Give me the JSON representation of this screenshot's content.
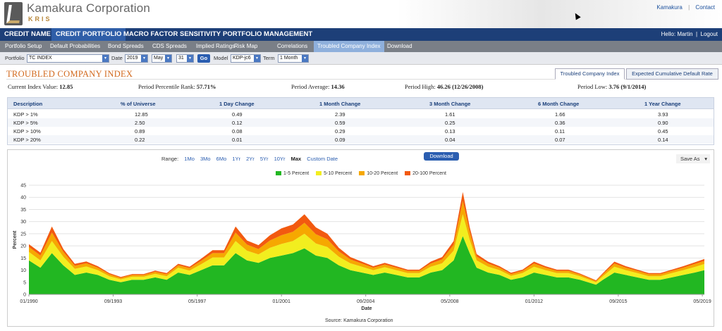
{
  "header": {
    "brand": "Kamakura Corporation",
    "brand_sub": "KRIS",
    "links": [
      "Kamakura",
      "Contact"
    ]
  },
  "main_nav": {
    "items": [
      "CREDIT NAME",
      "CREDIT PORTFOLIO",
      "MACRO FACTOR SENSITIVITY",
      "PORTFOLIO MANAGEMENT"
    ],
    "active": "CREDIT PORTFOLIO",
    "user_greeting": "Hello: Martin",
    "logout": "Logout"
  },
  "sub_nav": {
    "items": [
      "Portfolio Setup",
      "Default Probabilities",
      "Bond Spreads",
      "CDS Spreads",
      "Implied Ratings",
      "Risk Map",
      "Correlations",
      "Troubled Company Index",
      "Download"
    ],
    "active": "Troubled Company Index"
  },
  "filters": {
    "portfolio_label": "Portfolio",
    "portfolio_value": "TC INDEX",
    "date_label": "Date",
    "year": "2019",
    "month": "May",
    "day": "31",
    "go_label": "Go",
    "model_label": "Model",
    "model_value": "KDP-jc6",
    "term_label": "Term",
    "term_value": "1 Month"
  },
  "page": {
    "title": "TROUBLED COMPANY INDEX",
    "tabs": [
      "Troubled Company Index",
      "Expected Cumulative Default Rate"
    ],
    "active_tab": "Troubled Company Index"
  },
  "stats": {
    "current_label": "Current Index Value:",
    "current_value": "12.85",
    "percentile_label": "Period Percentile Rank:",
    "percentile_value": "57.71%",
    "average_label": "Period Average:",
    "average_value": "14.36",
    "high_label": "Period High:",
    "high_value": "46.26 (12/26/2008)",
    "low_label": "Period Low:",
    "low_value": "3.76 (9/1/2014)"
  },
  "table": {
    "headers": [
      "Description",
      "% of Universe",
      "1 Day Change",
      "1 Month Change",
      "3 Month Change",
      "6 Month Change",
      "1 Year Change"
    ],
    "rows": [
      [
        "KDP > 1%",
        "12.85",
        "0.49",
        "2.39",
        "1.61",
        "1.66",
        "3.93"
      ],
      [
        "KDP > 5%",
        "2.50",
        "0.12",
        "0.59",
        "0.25",
        "0.36",
        "0.90"
      ],
      [
        "KDP > 10%",
        "0.89",
        "0.08",
        "0.29",
        "0.13",
        "0.11",
        "0.45"
      ],
      [
        "KDP > 20%",
        "0.22",
        "0.01",
        "0.09",
        "0.04",
        "0.07",
        "0.14"
      ]
    ]
  },
  "chart_controls": {
    "range_label": "Range:",
    "ranges": [
      "1Mo",
      "3Mo",
      "6Mo",
      "1Yr",
      "2Yr",
      "5Yr",
      "10Yr",
      "Max",
      "Custom Date"
    ],
    "selected_range": "Max",
    "download_label": "Download",
    "save_as_label": "Save As"
  },
  "chart_data": {
    "type": "area",
    "stacked": true,
    "xlabel": "Date",
    "ylabel": "Percent",
    "ylim": [
      0,
      45
    ],
    "yticks": [
      0,
      5,
      10,
      15,
      20,
      25,
      30,
      35,
      40,
      45
    ],
    "xtick_labels": [
      "01/1990",
      "09/1993",
      "05/1997",
      "01/2001",
      "09/2004",
      "05/2008",
      "01/2012",
      "09/2015",
      "05/2019"
    ],
    "xtick_years": [
      1990.0,
      1993.67,
      1997.33,
      2001.0,
      2004.67,
      2008.33,
      2012.0,
      2015.67,
      2019.33
    ],
    "x_range": [
      1990.0,
      2019.42
    ],
    "grid": true,
    "legend_position": "top-center",
    "source": "Source: Kamakura Corporation",
    "x": [
      1990.0,
      1990.5,
      1991.0,
      1991.5,
      1992.0,
      1992.5,
      1993.0,
      1993.5,
      1994.0,
      1994.5,
      1995.0,
      1995.5,
      1996.0,
      1996.5,
      1997.0,
      1997.5,
      1998.0,
      1998.5,
      1999.0,
      1999.5,
      2000.0,
      2000.5,
      2001.0,
      2001.5,
      2002.0,
      2002.5,
      2003.0,
      2003.5,
      2004.0,
      2004.5,
      2005.0,
      2005.5,
      2006.0,
      2006.5,
      2007.0,
      2007.5,
      2008.0,
      2008.5,
      2008.9,
      2009.2,
      2009.5,
      2010.0,
      2010.5,
      2011.0,
      2011.5,
      2012.0,
      2012.5,
      2013.0,
      2013.5,
      2014.0,
      2014.7,
      2015.0,
      2015.5,
      2016.0,
      2016.5,
      2017.0,
      2017.5,
      2018.0,
      2018.5,
      2019.0,
      2019.42
    ],
    "series": [
      {
        "name": "1-5 Percent",
        "color": "#22b722",
        "values": [
          14,
          11,
          17,
          12,
          8,
          9,
          8,
          6,
          5,
          6,
          6,
          7,
          6,
          9,
          8,
          10,
          12,
          12,
          17,
          14,
          13,
          15,
          16,
          17,
          19,
          16,
          15,
          12,
          10,
          9,
          8,
          9,
          8,
          7,
          7,
          9,
          10,
          14,
          24,
          17,
          11,
          9,
          8,
          6,
          7,
          9,
          8,
          7,
          7,
          6,
          4,
          6,
          9,
          8,
          7,
          6,
          6,
          7,
          8,
          9,
          10
        ]
      },
      {
        "name": "5-10 Percent",
        "color": "#f2ee1f",
        "values": [
          3.5,
          3,
          5,
          3.5,
          2.5,
          2.5,
          2,
          1.5,
          1.2,
          1.3,
          1.3,
          1.5,
          1.5,
          2,
          1.8,
          2.4,
          3.2,
          3.2,
          5,
          4,
          3.5,
          4.2,
          4.8,
          5,
          6,
          5,
          4.5,
          3.5,
          2.8,
          2.4,
          2,
          2.2,
          2,
          1.8,
          1.8,
          2.4,
          2.8,
          4,
          9,
          5.5,
          3,
          2.4,
          2,
          1.6,
          1.8,
          2.4,
          2,
          1.8,
          1.8,
          1.5,
          1,
          1.5,
          2.4,
          2,
          1.8,
          1.5,
          1.5,
          1.8,
          2,
          2.3,
          2.5
        ]
      },
      {
        "name": "10-20 Percent",
        "color": "#f6a800",
        "values": [
          2,
          2,
          3.5,
          2,
          1.3,
          1.3,
          1,
          0.8,
          0.6,
          0.7,
          0.7,
          0.8,
          0.8,
          1,
          1,
          1.4,
          1.8,
          1.8,
          3.5,
          2.5,
          2.2,
          3,
          3.6,
          3.8,
          4.5,
          3.8,
          3.2,
          2.2,
          1.6,
          1.3,
          1,
          1.1,
          1,
          0.9,
          0.9,
          1.3,
          1.6,
          2.4,
          5.5,
          3.2,
          1.6,
          1.3,
          1,
          0.8,
          0.9,
          1.3,
          1,
          0.9,
          0.9,
          0.7,
          0.5,
          0.8,
          1.3,
          1,
          0.9,
          0.8,
          0.8,
          0.9,
          1,
          1.2,
          1.3
        ]
      },
      {
        "name": "20-100 Percent",
        "color": "#f25a10",
        "values": [
          1.2,
          1.2,
          2.5,
          1.2,
          0.8,
          0.8,
          0.6,
          0.5,
          0.4,
          0.4,
          0.4,
          0.5,
          0.5,
          0.6,
          0.6,
          0.9,
          1.2,
          1.2,
          2.5,
          1.7,
          1.6,
          2.2,
          2.8,
          3,
          3.5,
          2.8,
          2.3,
          1.5,
          1,
          0.8,
          0.6,
          0.7,
          0.6,
          0.5,
          0.5,
          0.8,
          1,
          1.6,
          3.7,
          2,
          1,
          0.8,
          0.6,
          0.5,
          0.5,
          0.8,
          0.6,
          0.5,
          0.5,
          0.4,
          0.3,
          0.5,
          0.8,
          0.6,
          0.5,
          0.5,
          0.5,
          0.5,
          0.6,
          0.7,
          0.8
        ]
      }
    ]
  }
}
